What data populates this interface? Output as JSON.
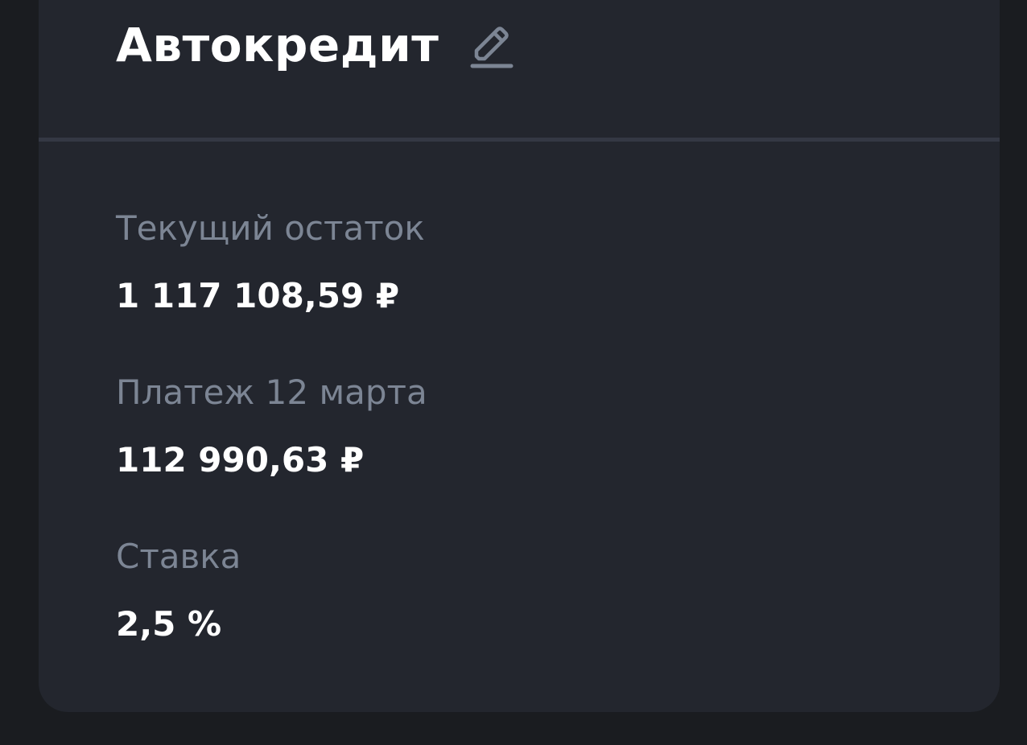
{
  "loan": {
    "title": "Автокредит",
    "edit_icon": "pencil-icon"
  },
  "fields": [
    {
      "label": "Текущий остаток",
      "value": "1 117 108,59 ₽"
    },
    {
      "label": "Платеж 12 марта",
      "value": "112 990,63 ₽"
    },
    {
      "label": "Ставка",
      "value": "2,5 %"
    }
  ],
  "colors": {
    "background": "#1a1c20",
    "card": "#23262e",
    "label": "#7c8594",
    "value": "#ffffff",
    "divider": "#343844",
    "icon": "#7c8594"
  }
}
